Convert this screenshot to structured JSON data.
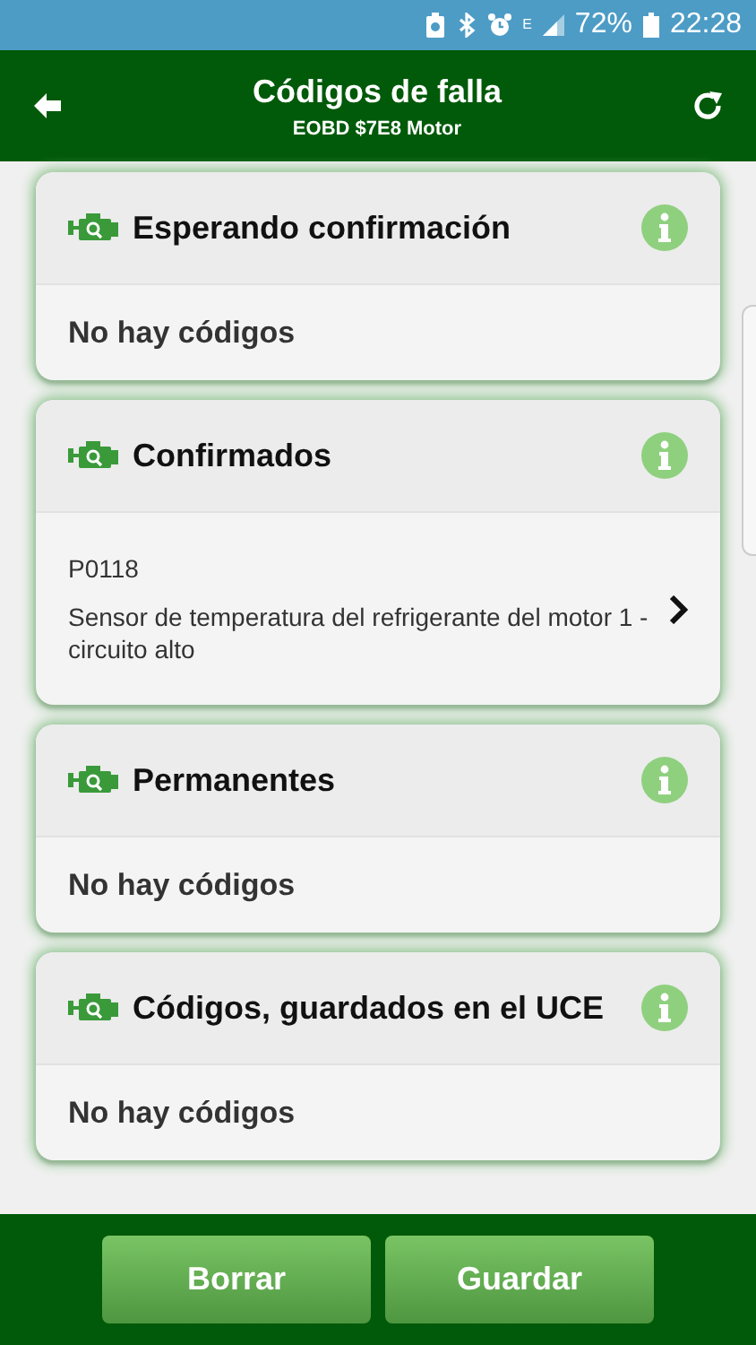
{
  "status_bar": {
    "network": "E",
    "battery": "72%",
    "time": "22:28"
  },
  "header": {
    "title": "Códigos de falla",
    "subtitle": "EOBD $7E8 Motor"
  },
  "sections": [
    {
      "title": "Esperando confirmación",
      "kind": "empty",
      "message": "No hay códigos"
    },
    {
      "title": "Confirmados",
      "kind": "codes",
      "codes": [
        {
          "code": "P0118",
          "description": "Sensor de temperatura del refrigerante del motor 1 - circuito alto"
        }
      ]
    },
    {
      "title": "Permanentes",
      "kind": "empty",
      "message": "No hay códigos"
    },
    {
      "title": "Códigos, guardados en el UCE",
      "kind": "empty",
      "message": "No hay códigos"
    }
  ],
  "buttons": [
    "Borrar",
    "Guardar"
  ]
}
